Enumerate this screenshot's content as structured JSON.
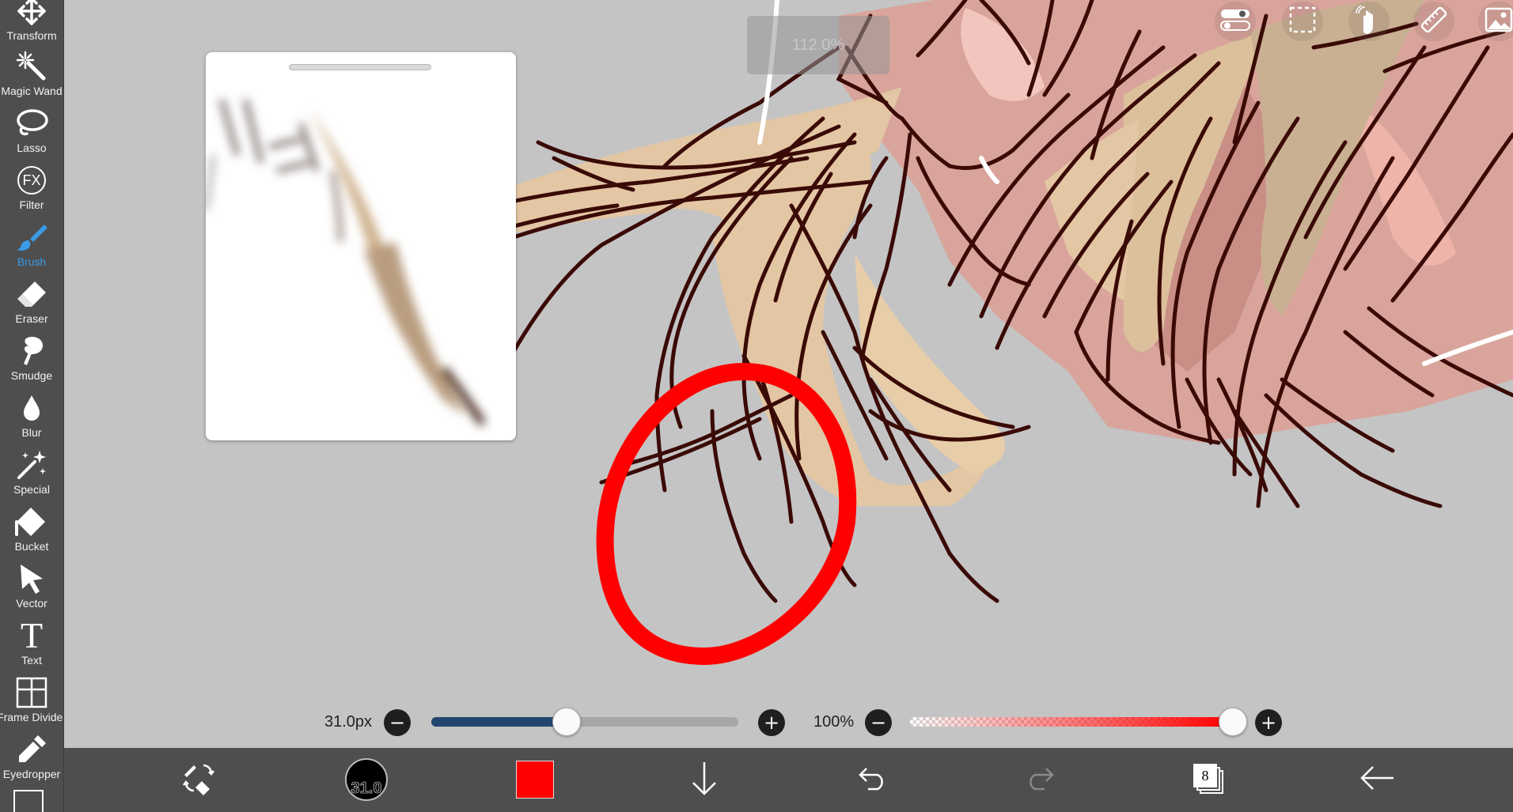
{
  "toolbar": {
    "tools": [
      {
        "label": "Transform",
        "icon": "transform-icon"
      },
      {
        "label": "Magic Wand",
        "icon": "magic-wand-icon"
      },
      {
        "label": "Lasso",
        "icon": "lasso-icon"
      },
      {
        "label": "Filter",
        "icon": "fx-icon",
        "icon_text": "FX"
      },
      {
        "label": "Brush",
        "icon": "brush-icon",
        "active": true
      },
      {
        "label": "Eraser",
        "icon": "eraser-icon"
      },
      {
        "label": "Smudge",
        "icon": "smudge-icon"
      },
      {
        "label": "Blur",
        "icon": "blur-icon"
      },
      {
        "label": "Special",
        "icon": "special-icon"
      },
      {
        "label": "Bucket",
        "icon": "bucket-icon"
      },
      {
        "label": "Vector",
        "icon": "vector-icon"
      },
      {
        "label": "Text",
        "icon": "text-icon",
        "icon_text": "T"
      },
      {
        "label": "Frame Divider",
        "icon": "frame-divider-icon"
      },
      {
        "label": "Eyedropper",
        "icon": "eyedropper-icon"
      }
    ],
    "active_color": "#3a9be6"
  },
  "canvas": {
    "zoom": "112.0%",
    "background_color": "#c4c4c4",
    "stroke_color": "#3a0a06",
    "hair_color": "#e3c6a4",
    "skin_color": "#d9a49b",
    "highlight_circle_color": "#ff0000"
  },
  "top_icons": [
    "toggle-icon",
    "selection-icon",
    "hand-gesture-icon",
    "ruler-icon",
    "image-icon"
  ],
  "brush_size": {
    "value_text": "31.0px",
    "fraction": 0.44,
    "fill_color": "#23466e"
  },
  "opacity": {
    "value_text": "100%",
    "fraction": 1.0,
    "color": "#ff0000"
  },
  "bottom_bar": {
    "brush_size_badge": "31.0",
    "current_color": "#ff0000",
    "layer_count": "8",
    "icons": [
      "swap-tools-icon",
      "brush-size-icon",
      "color-swatch",
      "download-icon",
      "undo-icon",
      "redo-icon",
      "layers-icon",
      "back-icon"
    ]
  }
}
